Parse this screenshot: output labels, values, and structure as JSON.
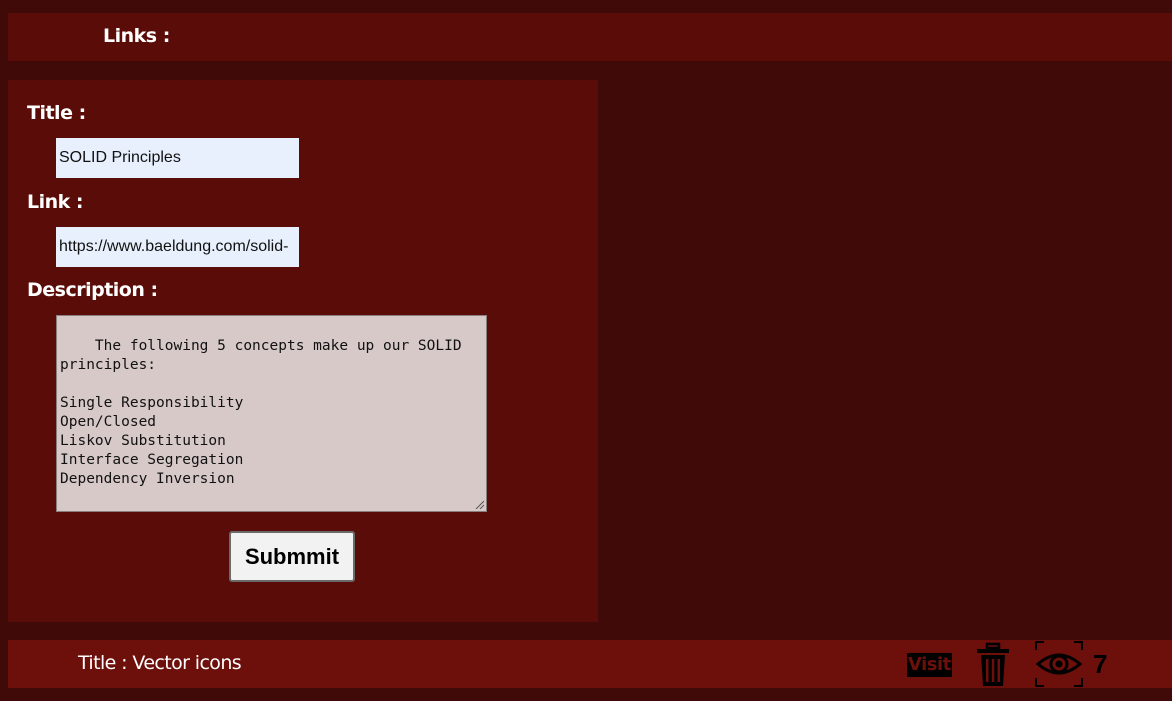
{
  "header": {
    "title": "Links :"
  },
  "form": {
    "title_label": "Title :",
    "title_value": "SOLID Principles",
    "link_label": "Link :",
    "link_value": "https://www.baeldung.com/solid-",
    "description_label": "Description :",
    "description_value": "The following 5 concepts make up our SOLID\nprinciples:\n\nSingle Responsibility\nOpen/Closed\nLiskov Substitution\nInterface Segregation\nDependency Inversion",
    "submit_label": "Submmit"
  },
  "link_item": {
    "title_text": "Title : Vector icons",
    "visit_label": "Visit",
    "delete_icon": "trash-icon",
    "views_icon": "eye-icon",
    "views_count": "7"
  },
  "colors": {
    "page_bg": "#3f0a07",
    "panel_bg": "#5a0d08",
    "row_bg": "#6d0f0a",
    "input_bg": "#e8f0fe",
    "textarea_bg": "#d8c9c9"
  }
}
